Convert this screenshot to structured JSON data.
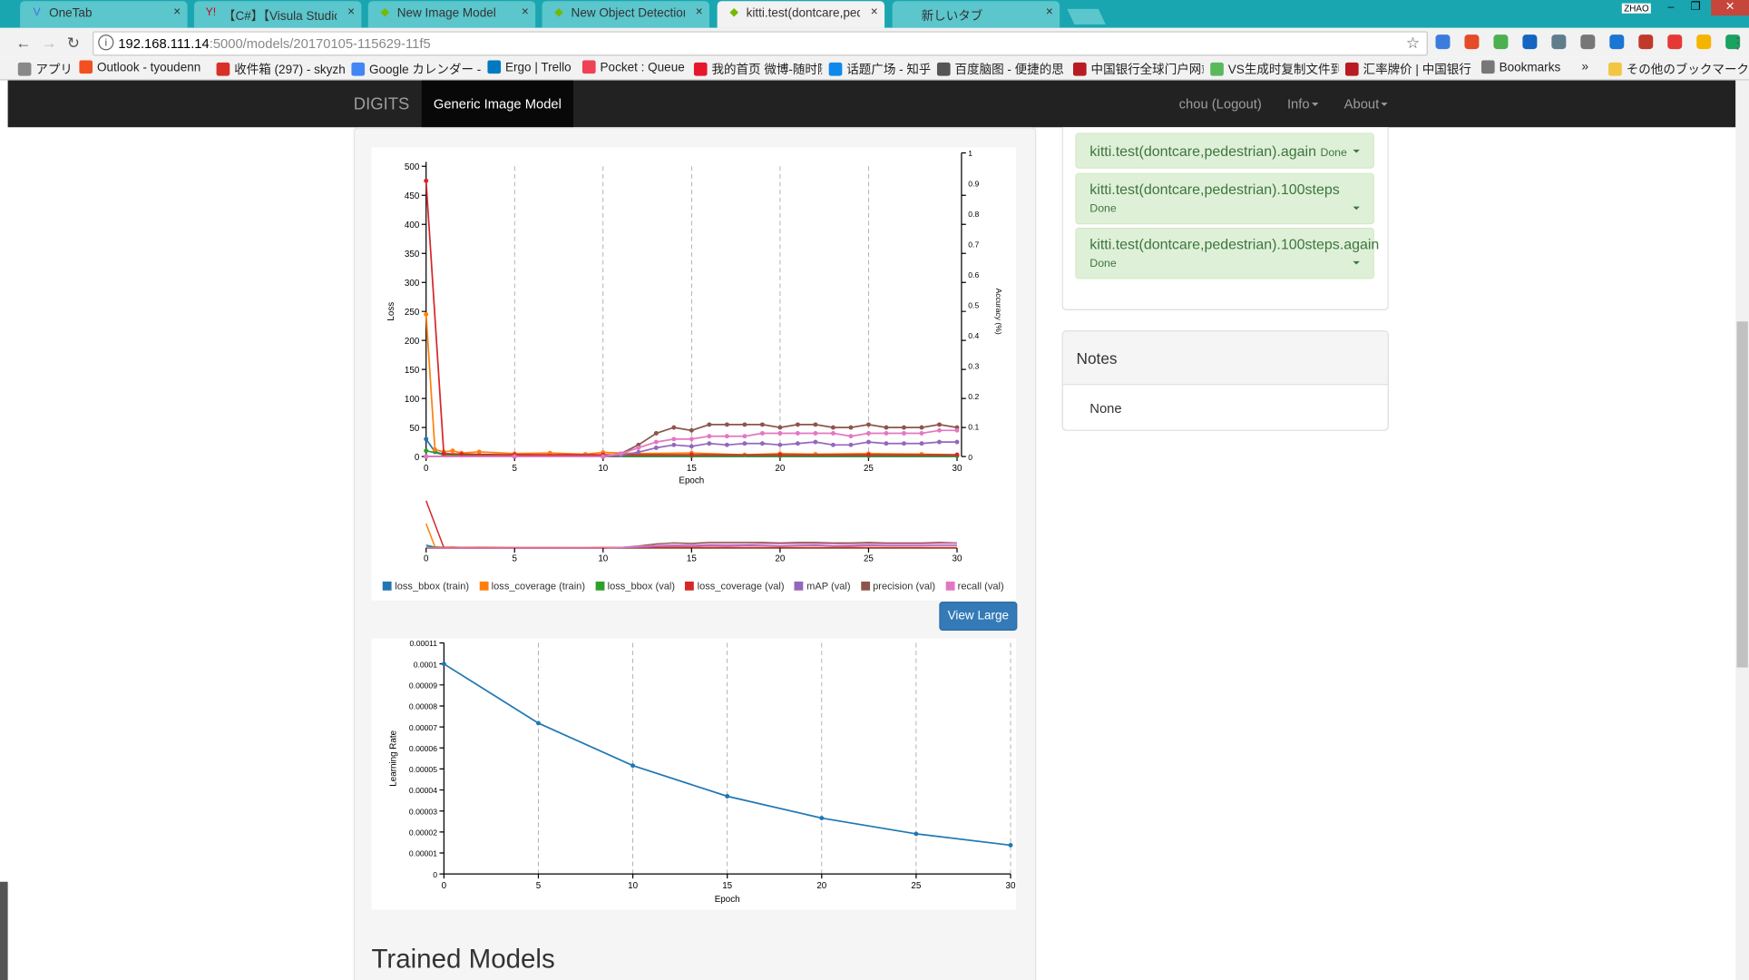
{
  "browser": {
    "tabs": [
      {
        "title": "OneTab",
        "icon": "onetab-icon",
        "color": "#4a6ee0",
        "glyph": "V"
      },
      {
        "title": "【C#】【Visula Studio",
        "icon": "yahoo-icon",
        "color": "#d0021b",
        "glyph": "Y!"
      },
      {
        "title": "New Image Model",
        "icon": "nvidia-icon",
        "color": "#76b900",
        "glyph": "◆"
      },
      {
        "title": "New Object Detection",
        "icon": "nvidia-icon",
        "color": "#76b900",
        "glyph": "◆"
      },
      {
        "title": "kitti.test(dontcare,ped",
        "icon": "nvidia-icon",
        "color": "#76b900",
        "glyph": "◆",
        "active": true
      },
      {
        "title": "新しいタブ",
        "icon": "blank-page-icon",
        "color": "#999999",
        "glyph": ""
      }
    ],
    "close_glyph": "×",
    "window_user": "ZHAO",
    "window_controls": {
      "minimize": "–",
      "maximize": "❐",
      "close": "✕"
    },
    "url_host": "192.168.111.14",
    "url_path": ":5000/models/20170105-115629-11f5",
    "bookmarks": [
      {
        "label": "アプリ",
        "color": "#888888"
      },
      {
        "label": "Outlook - tyoudenn",
        "color": "#f25022"
      },
      {
        "label": "收件箱 (297) - skyzh",
        "color": "#d93025"
      },
      {
        "label": "Google カレンダー -",
        "color": "#4285f4"
      },
      {
        "label": "Ergo | Trello",
        "color": "#0079bf"
      },
      {
        "label": "Pocket : Queue",
        "color": "#ef4056"
      },
      {
        "label": "我的首页 微博-随时随",
        "color": "#e6162d"
      },
      {
        "label": "话题广场 - 知乎",
        "color": "#0f88eb"
      },
      {
        "label": "百度脑图 - 便捷的思",
        "color": "#555555"
      },
      {
        "label": "中国银行全球门户网站",
        "color": "#b81c22"
      },
      {
        "label": "VS生成时复制文件到",
        "color": "#5cb85c"
      },
      {
        "label": "汇率牌价 | 中国银行",
        "color": "#b81c22"
      },
      {
        "label": "Bookmarks",
        "color": "#777777"
      }
    ],
    "bookmarks_more": "»",
    "other_bookmarks": "その他のブックマーク"
  },
  "navbar": {
    "brand": "DIGITS",
    "active": "Generic Image Model",
    "user": "chou (Logout)",
    "info": "Info",
    "about": "About"
  },
  "jobs": [
    {
      "name": "kitti.test(dontcare,pedestrian).again",
      "status": "Done"
    },
    {
      "name": "kitti.test(dontcare,pedestrian).100steps",
      "status": "Done"
    },
    {
      "name": "kitti.test(dontcare,pedestrian).100steps.again",
      "status": "Done"
    }
  ],
  "notes": {
    "title": "Notes",
    "body": "None"
  },
  "view_large": "View Large",
  "trained_models": "Trained Models",
  "colors": {
    "loss_bbox_train": "#1f77b4",
    "loss_coverage_train": "#ff7f0e",
    "loss_bbox_val": "#2ca02c",
    "loss_coverage_val": "#d62728",
    "mAP_val": "#9467bd",
    "precision_val": "#8c564b",
    "recall_val": "#e377c2",
    "accent": "#337ab7"
  },
  "chart_data": [
    {
      "type": "line",
      "xlabel": "Epoch",
      "ylabel": "Loss",
      "y2label": "Accuracy (%)",
      "xlim": [
        0,
        30
      ],
      "ylim": [
        0,
        500
      ],
      "y2lim": [
        0,
        1
      ],
      "xticks": [
        0,
        5,
        10,
        15,
        20,
        25,
        30
      ],
      "yticks": [
        0,
        50,
        100,
        150,
        200,
        250,
        300,
        350,
        400,
        450,
        500
      ],
      "y2ticks": [
        0,
        0.1,
        0.2,
        0.3,
        0.4,
        0.5,
        0.6,
        0.7,
        0.8,
        0.9,
        1
      ],
      "grid": "vertical dashed",
      "legend": "bottom",
      "series": [
        {
          "name": "loss_bbox (train)",
          "axis": "y",
          "x": [
            0,
            0.5,
            1,
            2,
            5,
            10,
            15,
            20,
            25,
            30
          ],
          "values": [
            30,
            8,
            4,
            3,
            2,
            2,
            2,
            2,
            2,
            2
          ]
        },
        {
          "name": "loss_coverage (train)",
          "axis": "y",
          "x": [
            0,
            0.5,
            1,
            1.5,
            2,
            3,
            5,
            7,
            9,
            10,
            12,
            15,
            18,
            20,
            22,
            25,
            28,
            30
          ],
          "values": [
            245,
            12,
            8,
            10,
            6,
            8,
            5,
            6,
            4,
            7,
            5,
            6,
            3,
            5,
            4,
            5,
            4,
            3
          ]
        },
        {
          "name": "loss_bbox (val)",
          "axis": "y",
          "x": [
            0,
            1,
            2,
            5,
            10,
            15,
            20,
            25,
            30
          ],
          "values": [
            10,
            3,
            2,
            1,
            1,
            1,
            1,
            1,
            1
          ]
        },
        {
          "name": "loss_coverage (val)",
          "axis": "y",
          "x": [
            0,
            1,
            2,
            5,
            10,
            15,
            20,
            25,
            30
          ],
          "values": [
            475,
            5,
            4,
            3,
            3,
            3,
            3,
            3,
            3
          ]
        },
        {
          "name": "mAP (val)",
          "axis": "y2",
          "x": [
            0,
            5,
            10,
            11,
            12,
            13,
            14,
            15,
            16,
            17,
            18,
            19,
            20,
            21,
            22,
            23,
            24,
            25,
            26,
            27,
            28,
            29,
            30
          ],
          "values": [
            0,
            0,
            0,
            0.005,
            0.015,
            0.03,
            0.04,
            0.035,
            0.045,
            0.04,
            0.045,
            0.045,
            0.04,
            0.045,
            0.05,
            0.04,
            0.04,
            0.05,
            0.045,
            0.045,
            0.045,
            0.05,
            0.05
          ]
        },
        {
          "name": "precision (val)",
          "axis": "y2",
          "x": [
            0,
            5,
            10,
            11,
            12,
            13,
            14,
            15,
            16,
            17,
            18,
            19,
            20,
            21,
            22,
            23,
            24,
            25,
            26,
            27,
            28,
            29,
            30
          ],
          "values": [
            0,
            0,
            0,
            0.01,
            0.04,
            0.08,
            0.1,
            0.09,
            0.11,
            0.11,
            0.11,
            0.11,
            0.1,
            0.11,
            0.11,
            0.1,
            0.1,
            0.11,
            0.1,
            0.1,
            0.1,
            0.11,
            0.1
          ]
        },
        {
          "name": "recall (val)",
          "axis": "y2",
          "x": [
            0,
            5,
            10,
            11,
            12,
            13,
            14,
            15,
            16,
            17,
            18,
            19,
            20,
            21,
            22,
            23,
            24,
            25,
            26,
            27,
            28,
            29,
            30
          ],
          "values": [
            0,
            0,
            0,
            0.01,
            0.03,
            0.05,
            0.06,
            0.06,
            0.07,
            0.07,
            0.07,
            0.08,
            0.08,
            0.08,
            0.08,
            0.08,
            0.07,
            0.08,
            0.08,
            0.08,
            0.08,
            0.09,
            0.09
          ]
        }
      ],
      "overview_xticks": [
        0,
        5,
        10,
        15,
        20,
        25,
        30
      ]
    },
    {
      "type": "line",
      "xlabel": "Epoch",
      "ylabel": "Learning Rate",
      "xlim": [
        0,
        30
      ],
      "ylim": [
        0,
        0.00011
      ],
      "xticks": [
        0,
        5,
        10,
        15,
        20,
        25,
        30
      ],
      "yticks": [
        "0",
        "0.00001",
        "0.00002",
        "0.00003",
        "0.00004",
        "0.00005",
        "0.00006",
        "0.00007",
        "0.00008",
        "0.00009",
        "0.0001",
        "0.00011"
      ],
      "grid": "vertical dashed",
      "series": [
        {
          "x": [
            0,
            5,
            10,
            15,
            20,
            25,
            30
          ],
          "values": [
            0.0001,
            7.18e-05,
            5.16e-05,
            3.7e-05,
            2.66e-05,
            1.91e-05,
            1.37e-05
          ]
        }
      ]
    }
  ]
}
